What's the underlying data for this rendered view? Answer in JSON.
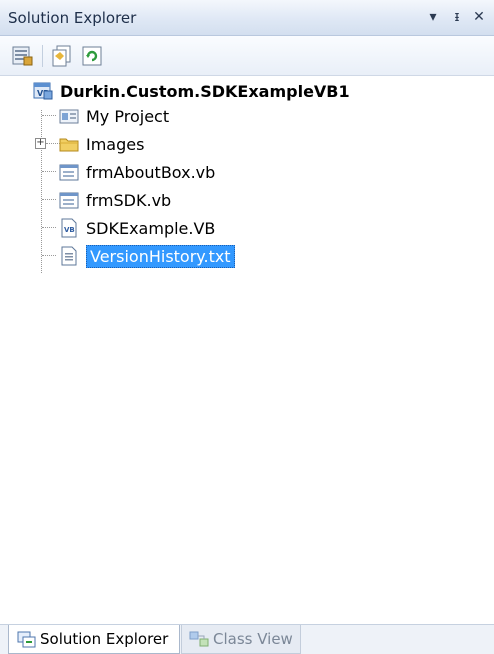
{
  "window": {
    "title": "Solution Explorer",
    "controls": {
      "dropdown": "▾",
      "pin": "ᵻ",
      "close": "✕"
    }
  },
  "toolbar": {
    "buttons": [
      {
        "icon": "properties-icon"
      },
      {
        "icon": "show-all-files-icon"
      },
      {
        "icon": "refresh-icon"
      }
    ]
  },
  "tree": {
    "root": {
      "label": "Durkin.Custom.SDKExampleVB1",
      "icon": "vb-project-icon"
    },
    "items": [
      {
        "label": "My Project",
        "icon": "my-project-icon"
      },
      {
        "label": "Images",
        "icon": "folder-icon",
        "expander": "+"
      },
      {
        "label": "frmAboutBox.vb",
        "icon": "form-icon"
      },
      {
        "label": "frmSDK.vb",
        "icon": "form-icon"
      },
      {
        "label": "SDKExample.VB",
        "icon": "vb-module-icon"
      },
      {
        "label": "VersionHistory.txt",
        "icon": "text-file-icon",
        "selected": true
      }
    ]
  },
  "tabs": [
    {
      "label": "Solution Explorer",
      "active": true,
      "icon": "solution-explorer-icon"
    },
    {
      "label": "Class View",
      "active": false,
      "icon": "class-view-icon"
    }
  ]
}
